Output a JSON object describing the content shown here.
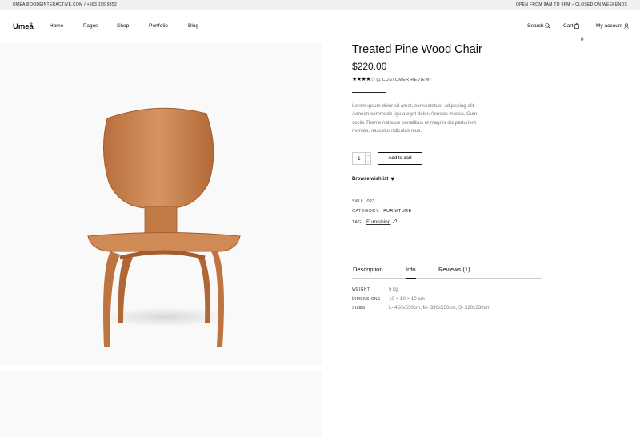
{
  "topbar": {
    "left": "UMEA@QODEINTERACTIVE.COM / +663 155 9852",
    "right": "OPEN FROM 9AM TO 9PM – CLOSED ON WEEKENDS"
  },
  "header": {
    "logo": "Umeå",
    "nav": [
      "Home",
      "Pages",
      "Shop",
      "Portfolio",
      "Blog"
    ],
    "search": "Search",
    "cart": "Cart",
    "cart_count": "0",
    "account": "My account"
  },
  "product": {
    "title": "Treated Pine Wood Chair",
    "price": "$220.00",
    "rating": 4,
    "rating_max": 5,
    "reviews_text": "(1 CUSTOMER REVIEW)",
    "description": "Lorem ipsum dolor sit amet, consectetuer adipiscing elit. Aenean commodo ligula eget dolor. Aenean massa. Cum sociis Theme natoque penatibus et magnis dis parturient montes, nascetur ridiculus mus.",
    "quantity": "1",
    "add_to_cart": "Add to cart",
    "wishlist": "Browse wishlist",
    "sku_label": "SKU:",
    "sku": "023",
    "category_label": "CATEGORY:",
    "category": "FURNITURE",
    "tag_label": "TAG:",
    "tag": "Furnishing"
  },
  "tabs": [
    "Description",
    "Info",
    "Reviews (1)"
  ],
  "info": [
    {
      "label": "WEIGHT",
      "value": "5 kg"
    },
    {
      "label": "DIMENSIONS",
      "value": "10 × 10 × 10 cm"
    },
    {
      "label": "SIZES",
      "value": "L- 450x550cm, M- 330x550cm, S- 220x330cm"
    }
  ],
  "colors": {
    "topbar_bg": "#f0f0f0",
    "gallery_bg": "#f9f9f9",
    "wood": "#c47c48"
  }
}
